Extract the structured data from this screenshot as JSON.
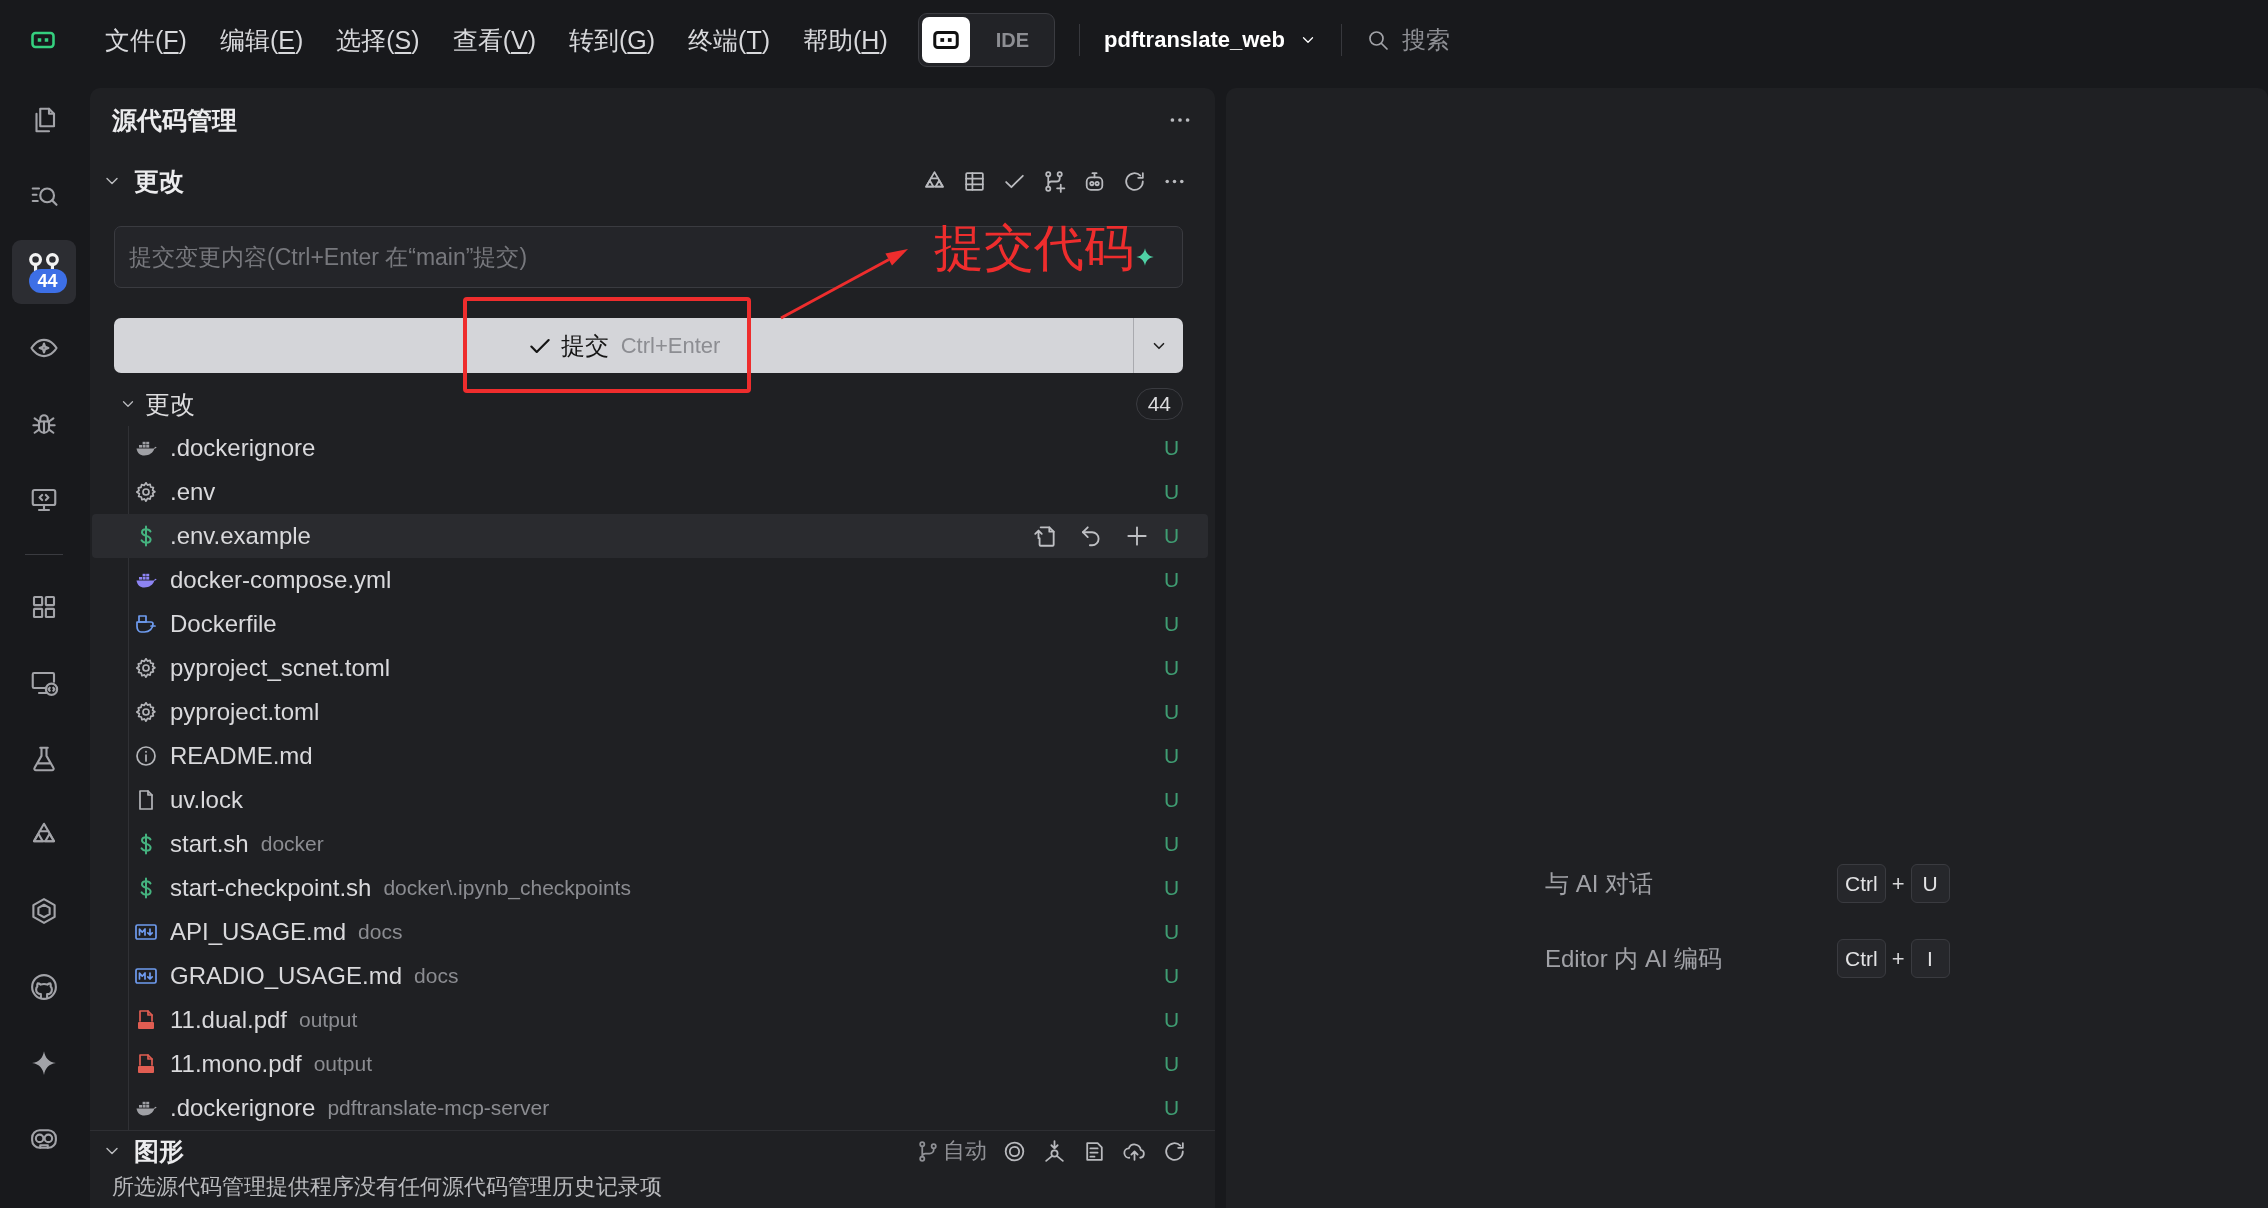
{
  "title_bar": {
    "menus": [
      {
        "label": "文件(",
        "mnemonic": "F",
        "suffix": ")"
      },
      {
        "label": "编辑(",
        "mnemonic": "E",
        "suffix": ")"
      },
      {
        "label": "选择(",
        "mnemonic": "S",
        "suffix": ")"
      },
      {
        "label": "查看(",
        "mnemonic": "V",
        "suffix": ")"
      },
      {
        "label": "转到(",
        "mnemonic": "G",
        "suffix": ")"
      },
      {
        "label": "终端(",
        "mnemonic": "T",
        "suffix": ")"
      },
      {
        "label": "帮助(",
        "mnemonic": "H",
        "suffix": ")"
      }
    ],
    "mode_switch": [
      {
        "kind": "icon",
        "selected": true
      },
      {
        "kind": "text",
        "label": "IDE",
        "selected": false
      }
    ],
    "project": "pdftranslate_web",
    "search": {
      "placeholder": "搜索"
    }
  },
  "activity_bar": {
    "top": [
      {
        "kind": "explorer",
        "selected": false
      },
      {
        "kind": "search",
        "selected": false
      },
      {
        "kind": "source-control",
        "selected": true,
        "badge": "44"
      },
      {
        "kind": "preview",
        "selected": false
      },
      {
        "kind": "debug",
        "selected": false
      },
      {
        "kind": "remote-code",
        "selected": false
      }
    ],
    "bottom": [
      {
        "kind": "extensions",
        "selected": false
      },
      {
        "kind": "remote",
        "selected": false
      },
      {
        "kind": "testing",
        "selected": false
      },
      {
        "kind": "agent",
        "selected": false
      },
      {
        "kind": "hexagon",
        "selected": false
      },
      {
        "kind": "github",
        "selected": false
      },
      {
        "kind": "ai",
        "selected": false
      },
      {
        "kind": "robot",
        "selected": false
      }
    ]
  },
  "source_control": {
    "title": "源代码管理",
    "changes_section": {
      "title": "更改",
      "expanded": true
    },
    "commit_message": {
      "placeholder": "提交变更内容(Ctrl+Enter 在“main”提交)"
    },
    "commit_button": {
      "label": "提交",
      "shortcut": "Ctrl+Enter"
    },
    "changes_group": {
      "title": "更改",
      "expanded": true,
      "count": "44",
      "files": [
        {
          "kind": "docker",
          "name": ".dockerignore",
          "status": "U",
          "hovered": false
        },
        {
          "kind": "gear",
          "name": ".env",
          "status": "U",
          "hovered": false
        },
        {
          "kind": "shell",
          "name": ".env.example",
          "status": "U",
          "hovered": true
        },
        {
          "kind": "compose",
          "name": "docker-compose.yml",
          "status": "U",
          "hovered": false
        },
        {
          "kind": "dockerfile",
          "name": "Dockerfile",
          "status": "U",
          "hovered": false
        },
        {
          "kind": "gear",
          "name": "pyproject_scnet.toml",
          "status": "U",
          "hovered": false
        },
        {
          "kind": "gear",
          "name": "pyproject.toml",
          "status": "U",
          "hovered": false
        },
        {
          "kind": "info",
          "name": "README.md",
          "status": "U",
          "hovered": false
        },
        {
          "kind": "file",
          "name": "uv.lock",
          "status": "U",
          "hovered": false
        },
        {
          "kind": "shell",
          "name": "start.sh",
          "folder": "docker",
          "status": "U",
          "hovered": false
        },
        {
          "kind": "shell",
          "name": "start-checkpoint.sh",
          "folder": "docker\\.ipynb_checkpoints",
          "status": "U",
          "hovered": false
        },
        {
          "kind": "markdown",
          "name": "API_USAGE.md",
          "folder": "docs",
          "status": "U",
          "hovered": false
        },
        {
          "kind": "markdown",
          "name": "GRADIO_USAGE.md",
          "folder": "docs",
          "status": "U",
          "hovered": false
        },
        {
          "kind": "pdf",
          "name": "11.dual.pdf",
          "folder": "output",
          "status": "U",
          "hovered": false
        },
        {
          "kind": "pdf",
          "name": "11.mono.pdf",
          "folder": "output",
          "status": "U",
          "hovered": false
        },
        {
          "kind": "docker",
          "name": ".dockerignore",
          "folder": "pdftranslate-mcp-server",
          "status": "U",
          "hovered": false
        }
      ]
    },
    "graph_section": {
      "title": "图形",
      "expanded": true,
      "auto_label": "自动",
      "message": "所选源代码管理提供程序没有任何源代码管理历史记录项"
    }
  },
  "annotation": {
    "text": "提交代码"
  },
  "shortcuts": [
    {
      "label": "与 AI 对话",
      "keys": [
        {
          "kind": "key",
          "label": "Ctrl"
        },
        {
          "kind": "plus",
          "label": "+"
        },
        {
          "kind": "key",
          "label": "U"
        }
      ]
    },
    {
      "label": "Editor 内 AI 编码",
      "keys": [
        {
          "kind": "key",
          "label": "Ctrl"
        },
        {
          "kind": "plus",
          "label": "+"
        },
        {
          "kind": "key",
          "label": "I"
        }
      ]
    }
  ]
}
